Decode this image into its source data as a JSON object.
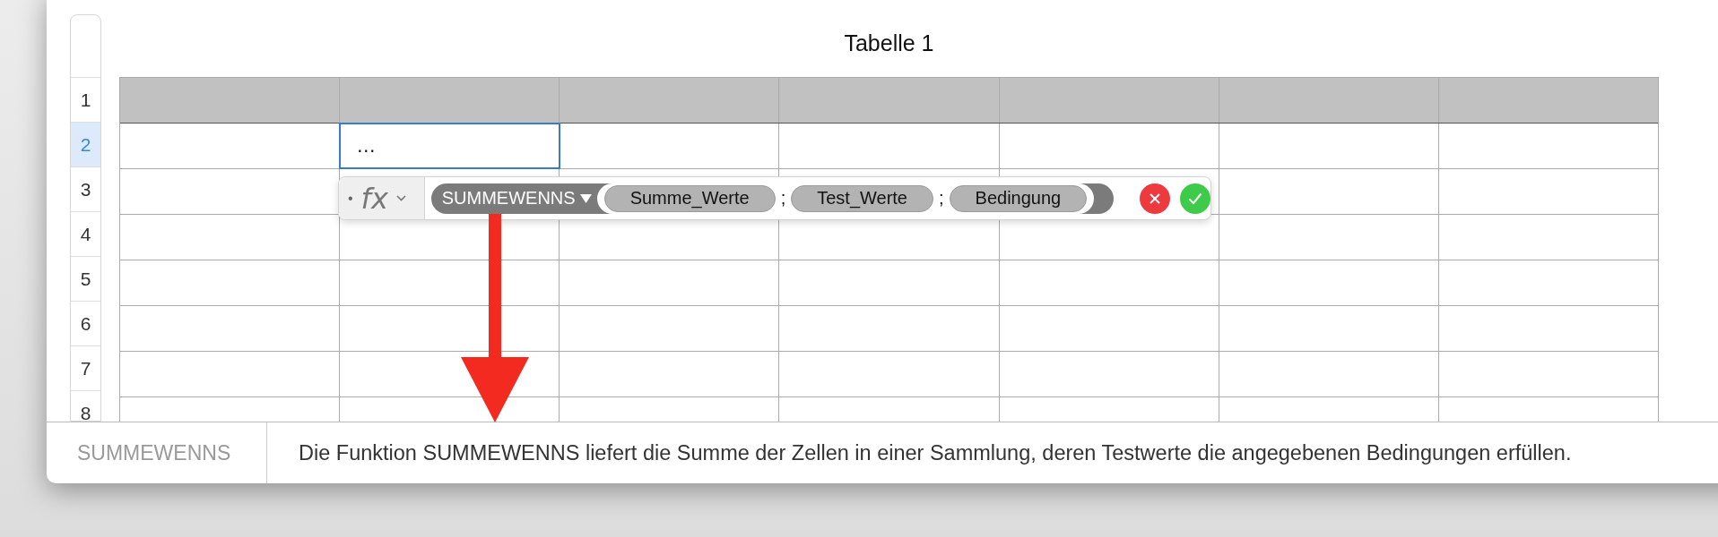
{
  "table": {
    "title": "Tabelle 1",
    "rows": [
      {
        "number": "1",
        "selected": false,
        "kind": "header"
      },
      {
        "number": "2",
        "selected": true,
        "kind": "body",
        "cells": [
          {
            "selected": false
          },
          {
            "selected": true,
            "value": "…"
          }
        ]
      },
      {
        "number": "3",
        "selected": false,
        "kind": "body"
      },
      {
        "number": "4",
        "selected": false,
        "kind": "body"
      },
      {
        "number": "5",
        "selected": false,
        "kind": "body"
      },
      {
        "number": "6",
        "selected": false,
        "kind": "body"
      },
      {
        "number": "7",
        "selected": false,
        "kind": "body"
      },
      {
        "number": "8",
        "selected": false,
        "kind": "body"
      }
    ]
  },
  "formula_editor": {
    "bullet": "•",
    "fx": "fx",
    "tokens": [
      {
        "kind": "function",
        "label": "SUMMEWENNS"
      },
      {
        "kind": "argument",
        "label": "Summe_Werte"
      },
      {
        "kind": "separator",
        "label": ";"
      },
      {
        "kind": "argument",
        "label": "Test_Werte"
      },
      {
        "kind": "separator",
        "label": ";"
      },
      {
        "kind": "argument",
        "label": "Bedingung"
      }
    ]
  },
  "function_help": {
    "name": "SUMMEWENNS",
    "description": "Die Funktion SUMMEWENNS liefert die Summe der Zellen in einer Sammlung, deren Testwerte die angegebenen Bedingungen erfüllen."
  }
}
